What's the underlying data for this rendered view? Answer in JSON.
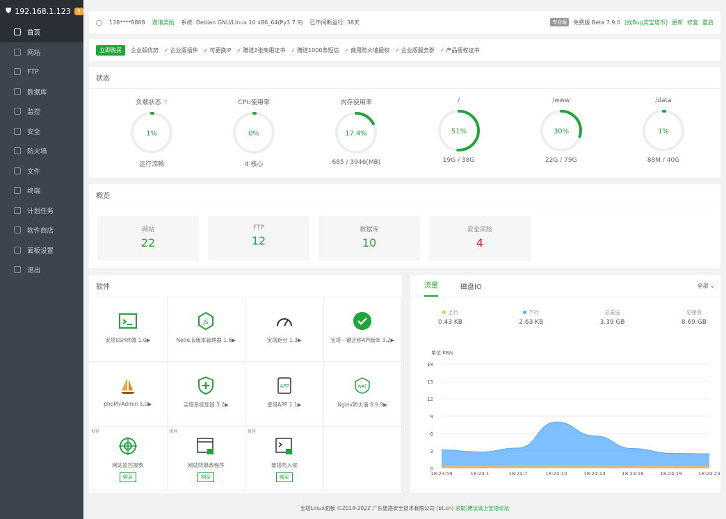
{
  "sidebar": {
    "ip": "192.168.1.123",
    "badge": "0",
    "items": [
      {
        "label": "首页"
      },
      {
        "label": "网站"
      },
      {
        "label": "FTP"
      },
      {
        "label": "数据库"
      },
      {
        "label": "监控"
      },
      {
        "label": "安全"
      },
      {
        "label": "防火墙"
      },
      {
        "label": "文件"
      },
      {
        "label": "终端"
      },
      {
        "label": "计划任务"
      },
      {
        "label": "软件商店"
      },
      {
        "label": "面板设置"
      },
      {
        "label": "退出"
      }
    ]
  },
  "topbar": {
    "user": "138****8888",
    "invite": "邀请奖励",
    "system": "系统: Debian GNU/Linux 10 x86_64(Py3.7.9)",
    "uptime": "已不间断运行: 38天",
    "edition_badge": "专业版",
    "version": "免费版 Beta 7.9.0",
    "bug_link": "[找Bug奖宝塔币]",
    "update": "更新",
    "repair": "修复",
    "restart": "重启"
  },
  "pro": {
    "buy": "立即购买",
    "title": "企业版优势",
    "features": [
      "企业版插件",
      "可更换IP",
      "赠送2张商用证书",
      "赠送1000条短信",
      "商用防火墙授权",
      "企业版服务群",
      "产品授权证书"
    ]
  },
  "status": {
    "title": "状态",
    "gauges": [
      {
        "label": "负载状态",
        "value": "1%",
        "fraction": 0.01,
        "sub": "运行流畅",
        "help": "?"
      },
      {
        "label": "CPU使用率",
        "value": "0%",
        "fraction": 0.0,
        "sub": "4 核心"
      },
      {
        "label": "内存使用率",
        "value": "17.4%",
        "fraction": 0.174,
        "sub": "685 / 3946(MB)"
      },
      {
        "label": "/",
        "value": "51%",
        "fraction": 0.51,
        "sub": "19G / 38G"
      },
      {
        "label": "/www",
        "value": "30%",
        "fraction": 0.3,
        "sub": "22G / 79G"
      },
      {
        "label": "/data",
        "value": "1%",
        "fraction": 0.01,
        "sub": "88M / 40G"
      }
    ]
  },
  "overview": {
    "title": "概览",
    "cards": [
      {
        "label": "网站",
        "value": "22",
        "color": "#20a53a"
      },
      {
        "label": "FTP",
        "value": "12",
        "color": "#20a53a"
      },
      {
        "label": "数据库",
        "value": "10",
        "color": "#20a53a"
      },
      {
        "label": "安全风险",
        "value": "4",
        "color": "#e02020"
      }
    ]
  },
  "software": {
    "title": "软件",
    "items": [
      {
        "name": "宝塔SSH终端 1.0▶",
        "icon": "terminal-icon"
      },
      {
        "name": "Node.js版本管理器 1.6▶",
        "icon": "nodejs-icon"
      },
      {
        "name": "宝塔跑分 1.3▶",
        "icon": "speedometer-icon"
      },
      {
        "name": "宝塔一键迁移API版本 3.2▶",
        "icon": "check-circle-icon"
      },
      {
        "name": "phpMyAdmin 5.0▶",
        "icon": "sailboat-icon"
      },
      {
        "name": "宝塔系统加固 3.2▶",
        "icon": "shield-plus-icon"
      },
      {
        "name": "堡塔APP 1.1▶",
        "icon": "app-icon"
      },
      {
        "name": "Nginx防火墙 8.9.9▶",
        "icon": "waf-icon"
      },
      {
        "name": "网站监控报表",
        "icon": "globe-target-icon",
        "tag": "推荐",
        "buy": "购买"
      },
      {
        "name": "网站防篡改程序",
        "icon": "browser-lock-icon",
        "tag": "推荐",
        "buy": "购买"
      },
      {
        "name": "堡塔防入侵",
        "icon": "terminal-lock-icon",
        "tag": "推荐",
        "buy": "购买"
      }
    ]
  },
  "traffic": {
    "tabs": [
      "流量",
      "磁盘IO"
    ],
    "select": "全部",
    "stats": [
      {
        "label": "上行",
        "value": "0.43 KB",
        "color": "#f7b851"
      },
      {
        "label": "下行",
        "value": "2.63 KB",
        "color": "#52a9ff"
      },
      {
        "label": "总发送",
        "value": "3.39 GB"
      },
      {
        "label": "总接收",
        "value": "8.69 GB"
      }
    ]
  },
  "chart_data": {
    "type": "area",
    "ylabel": "单位:KB/s",
    "ylim": [
      0,
      18
    ],
    "yticks": [
      0,
      3,
      6,
      9,
      12,
      15,
      18
    ],
    "x": [
      "18:23:59",
      "18:24:1",
      "18:24:7",
      "18:24:10",
      "18:24:13",
      "18:24:16",
      "18:24:19",
      "18:24:23"
    ],
    "series": [
      {
        "name": "下行",
        "color": "#52a9ff",
        "values": [
          3.2,
          2.8,
          3.5,
          8.0,
          5.6,
          3.4,
          2.6,
          2.5
        ]
      },
      {
        "name": "上行",
        "color": "#f7b851",
        "values": [
          0.4,
          0.4,
          0.5,
          0.5,
          0.5,
          0.4,
          0.4,
          0.4
        ]
      }
    ]
  },
  "footer": {
    "text": "宝塔Linux面板 ©2014-2022 广东堡塔安全技术有限公司 (bt.cn)",
    "link": "求助|建议请上宝塔论坛"
  }
}
